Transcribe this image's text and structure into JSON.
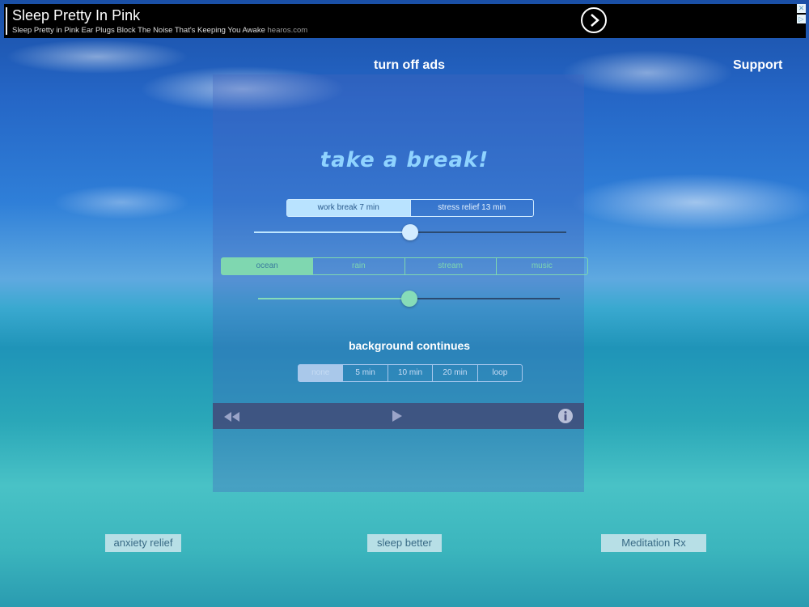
{
  "ad": {
    "title": "Sleep Pretty In Pink",
    "subtitle": "Sleep Pretty in Pink Ear Plugs Block The Noise That's Keeping You Awake",
    "domain": "hearos.com",
    "close_symbol": "✕",
    "info_symbol": "▷"
  },
  "header": {
    "turn_off_ads": "turn off ads",
    "support": "Support"
  },
  "panel": {
    "title": "take a break!",
    "break_modes": [
      {
        "label": "work break 7 min",
        "selected": true
      },
      {
        "label": "stress relief 13 min",
        "selected": false
      }
    ],
    "duration_slider": {
      "value_fraction": 0.5
    },
    "sounds": [
      {
        "label": "ocean",
        "selected": true
      },
      {
        "label": "rain",
        "selected": false
      },
      {
        "label": "stream",
        "selected": false
      },
      {
        "label": "music",
        "selected": false
      }
    ],
    "volume_slider": {
      "value_fraction": 0.5
    },
    "background_label": "background continues",
    "background_options": [
      {
        "label": "none",
        "selected": true
      },
      {
        "label": "5 min",
        "selected": false
      },
      {
        "label": "10 min",
        "selected": false
      },
      {
        "label": "20 min",
        "selected": false
      },
      {
        "label": "loop",
        "selected": false
      }
    ]
  },
  "player": {
    "icons": [
      "rewind-icon",
      "play-icon",
      "info-icon"
    ]
  },
  "footer": {
    "buttons": [
      "anxiety relief",
      "sleep better",
      "Meditation Rx"
    ]
  },
  "colors": {
    "accent_blue": "#b9e3ff",
    "accent_green": "#7fd7b0",
    "title": "#8fd3ff"
  }
}
